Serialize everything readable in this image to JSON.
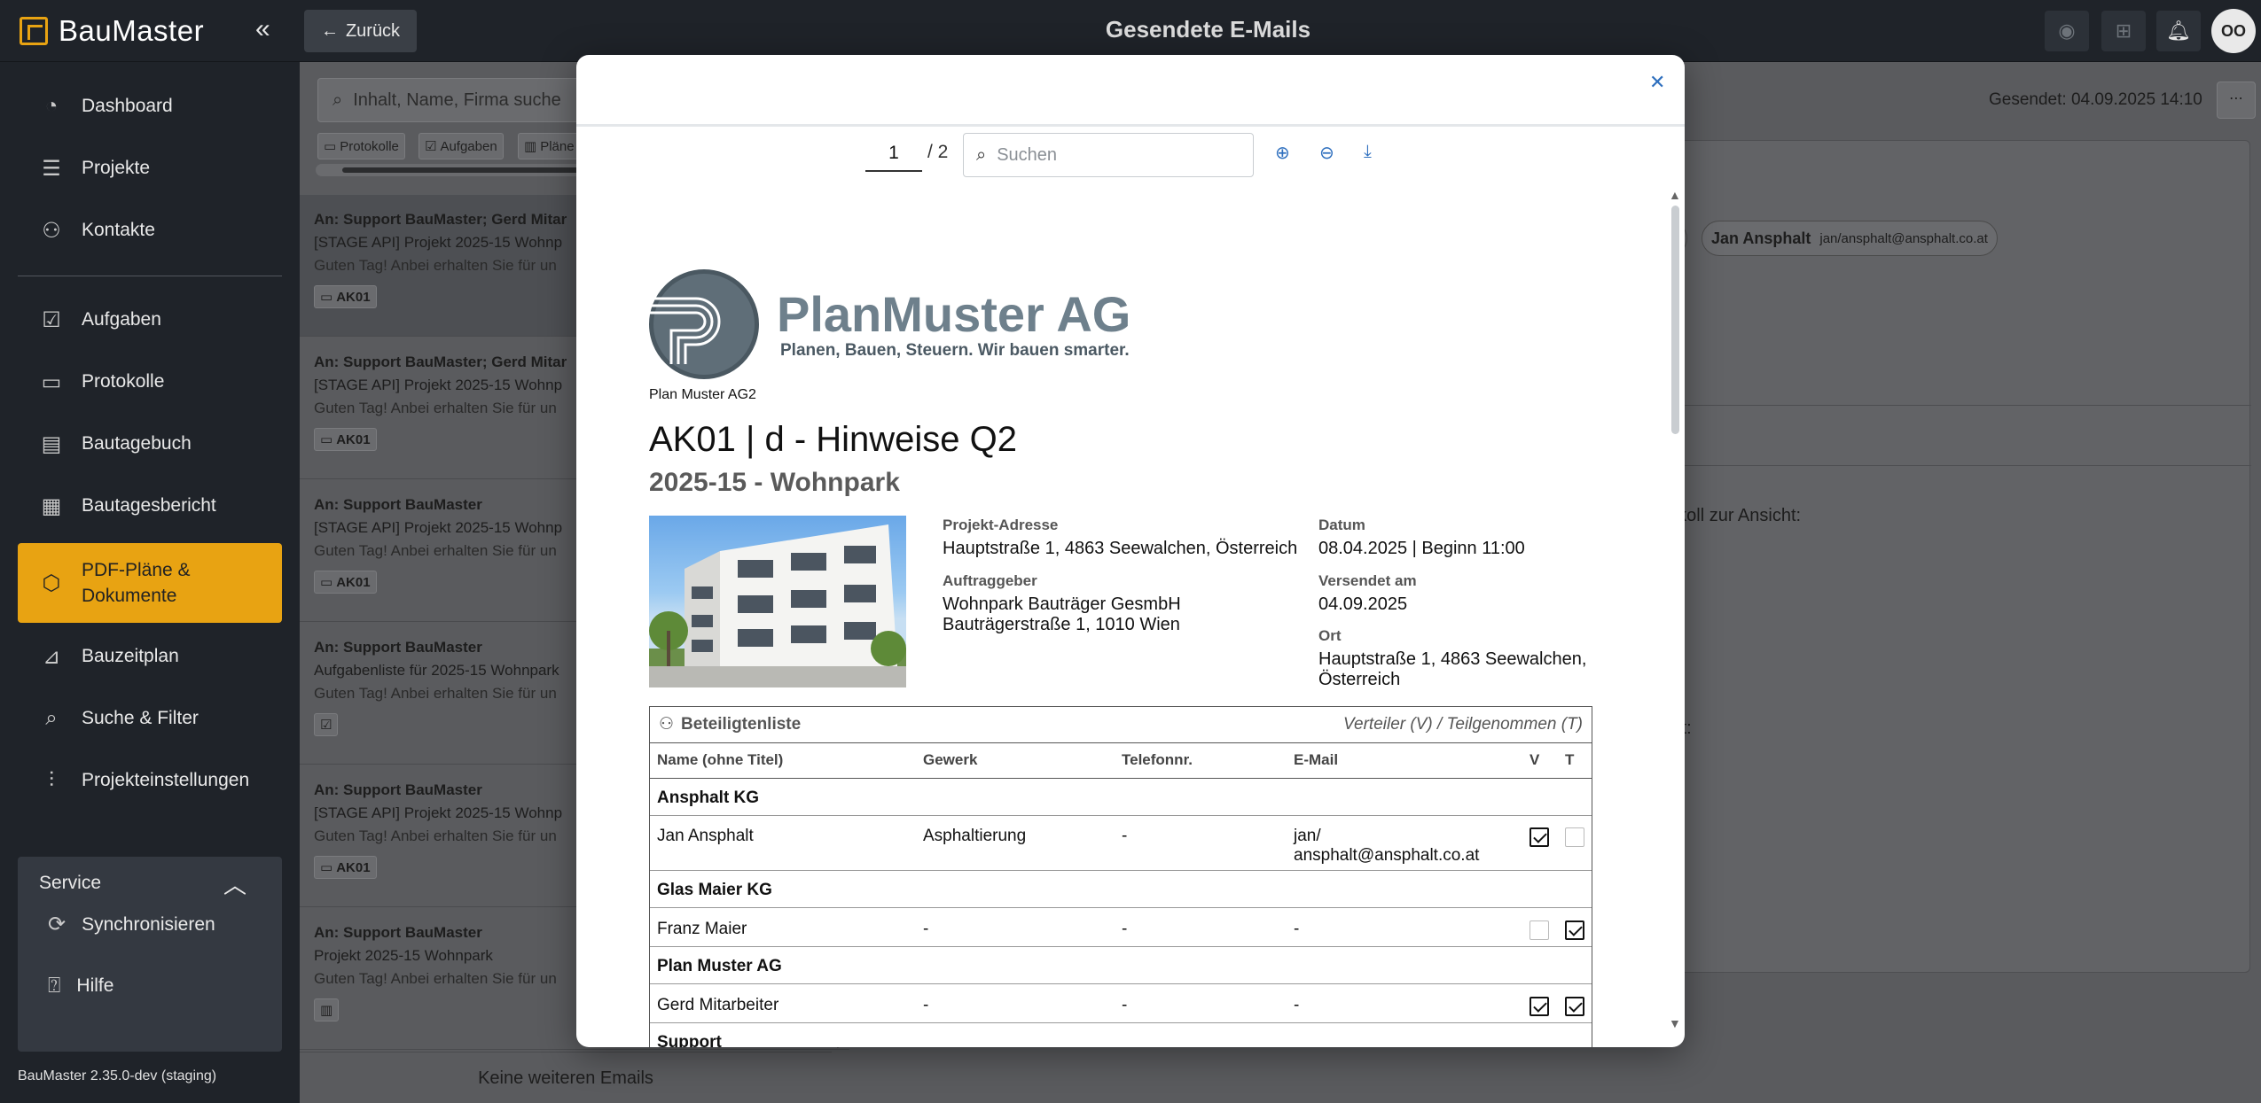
{
  "app": {
    "name": "BauMaster",
    "version": "BauMaster 2.35.0-dev (staging)"
  },
  "header": {
    "back_label": "Zurück",
    "title": "Gesendete E-Mails",
    "avatar_initials": "OO"
  },
  "sidebar": {
    "items": [
      {
        "label": "Dashboard",
        "icon": "dashboard-icon"
      },
      {
        "label": "Projekte",
        "icon": "list-icon"
      },
      {
        "label": "Kontakte",
        "icon": "person-icon"
      },
      {
        "label": "Aufgaben",
        "icon": "clipboard-check-icon"
      },
      {
        "label": "Protokolle",
        "icon": "clipboard-icon"
      },
      {
        "label": "Bautagebuch",
        "icon": "document-icon"
      },
      {
        "label": "Bautagesbericht",
        "icon": "building-icon"
      },
      {
        "label": "PDF-Pläne & Dokumente",
        "icon": "cube-icon"
      },
      {
        "label": "Bauzeitplan",
        "icon": "gantt-icon"
      },
      {
        "label": "Suche & Filter",
        "icon": "search-document-icon"
      },
      {
        "label": "Projekteinstellungen",
        "icon": "sliders-icon"
      }
    ],
    "active_index": 7,
    "service": {
      "label": "Service",
      "items": [
        {
          "label": "Synchronisieren"
        },
        {
          "label": "Hilfe"
        }
      ]
    }
  },
  "email_list": {
    "search_placeholder": "Inhalt, Name, Firma suche",
    "filter_chips": [
      "Protokolle",
      "Aufgaben",
      "Pläne"
    ],
    "mails": [
      {
        "to": "An: Support BauMaster; Gerd Mitar",
        "subject": "[STAGE API] Projekt 2025-15 Wohnp",
        "preview": "Guten Tag! Anbei erhalten Sie für un",
        "tag": "AK01"
      },
      {
        "to": "An: Support BauMaster; Gerd Mitar",
        "subject": "[STAGE API] Projekt 2025-15 Wohnp",
        "preview": "Guten Tag! Anbei erhalten Sie für un",
        "tag": "AK01"
      },
      {
        "to": "An: Support BauMaster",
        "subject": "[STAGE API] Projekt 2025-15 Wohnp",
        "preview": "Guten Tag! Anbei erhalten Sie für un",
        "tag": "AK01"
      },
      {
        "to": "An: Support BauMaster",
        "subject": "Aufgabenliste für 2025-15 Wohnpark",
        "preview": "Guten Tag! Anbei erhalten Sie für un",
        "tag": ""
      },
      {
        "to": "An: Support BauMaster",
        "subject": "[STAGE API] Projekt 2025-15 Wohnp",
        "preview": "Guten Tag! Anbei erhalten Sie für un",
        "tag": "AK01"
      },
      {
        "to": "An: Support BauMaster",
        "subject": "Projekt 2025-15 Wohnpark",
        "preview": "Guten Tag! Anbei erhalten Sie für un",
        "tag": ""
      }
    ],
    "no_more": "Keine weiteren Emails"
  },
  "detail": {
    "sent": "Gesendet: 04.09.2025 14:10",
    "recipient_name": "Jan Ansphalt",
    "recipient_email": "jan/ansphalt@ansphalt.co.at",
    "body_fragment_1": "okoll zur Ansicht:",
    "body_fragment_2": "ält:"
  },
  "pdf_viewer": {
    "page_current": "1",
    "page_total": "/ 2",
    "search_placeholder": "Suchen",
    "document": {
      "company_name": "PlanMuster AG",
      "company_slogan": "Planen, Bauen, Steuern. Wir bauen smarter.",
      "company_sub": "Plan Muster AG2",
      "title": "AK01 | d - Hinweise Q2",
      "subtitle": "2025-15 - Wohnpark",
      "meta": {
        "address_label": "Projekt-Adresse",
        "address": "Hauptstraße 1, 4863 Seewalchen, Österreich",
        "client_label": "Auftraggeber",
        "client_line1": "Wohnpark Bauträger GesmbH",
        "client_line2": "Bauträgerstraße 1, 1010 Wien",
        "date_label": "Datum",
        "date": "08.04.2025 | Beginn 11:00",
        "sent_label": "Versendet am",
        "sent": "04.09.2025",
        "place_label": "Ort",
        "place_line1": "Hauptstraße 1, 4863 Seewalchen,",
        "place_line2": "Österreich"
      },
      "participants": {
        "title": "Beteiligtenliste",
        "legend": "Verteiler (V) / Teilgenommen (T)",
        "headers": [
          "Name (ohne Titel)",
          "Gewerk",
          "Telefonnr.",
          "E-Mail",
          "V",
          "T"
        ],
        "groups": [
          {
            "name": "Ansphalt KG",
            "rows": [
              {
                "name": "Jan Ansphalt",
                "trade": "Asphaltierung",
                "phone": "-",
                "email_1": "jan/",
                "email_2": "ansphalt@ansphalt.co.at",
                "v": true,
                "t": false
              }
            ]
          },
          {
            "name": "Glas Maier KG",
            "rows": [
              {
                "name": "Franz Maier",
                "trade": "-",
                "phone": "-",
                "email_1": "-",
                "email_2": "",
                "v": false,
                "t": true
              }
            ]
          },
          {
            "name": "Plan Muster AG",
            "rows": [
              {
                "name": "Gerd Mitarbeiter",
                "trade": "-",
                "phone": "-",
                "email_1": "-",
                "email_2": "",
                "v": true,
                "t": true
              }
            ]
          },
          {
            "name": "Support",
            "rows": []
          }
        ]
      }
    }
  },
  "colors": {
    "accent": "#e8a312",
    "dark": "#1f2329",
    "link": "#2e6fbe"
  }
}
